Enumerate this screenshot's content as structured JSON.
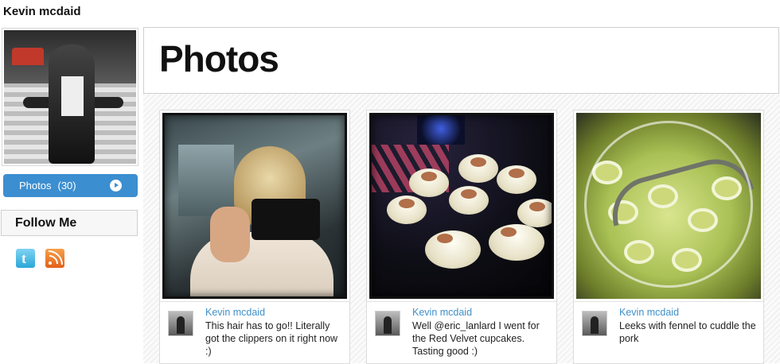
{
  "profile": {
    "name": "Kevin mcdaid",
    "photos_button": {
      "label": "Photos",
      "count": "(30)"
    },
    "follow": {
      "title": "Follow Me",
      "icons": [
        "twitter-icon",
        "rss-icon"
      ]
    }
  },
  "main": {
    "title": "Photos",
    "posts": [
      {
        "author": "Kevin mcdaid",
        "caption": "This hair has to go!! Literally got the clippers on it right now :)"
      },
      {
        "author": "Kevin mcdaid",
        "caption": "Well @eric_lanlard I went for the Red Velvet cupcakes. Tasting good :)"
      },
      {
        "author": "Kevin mcdaid",
        "caption": "Leeks with fennel to cuddle the pork"
      }
    ]
  },
  "colors": {
    "accent": "#3b8ed0",
    "link": "#3f90c9"
  }
}
